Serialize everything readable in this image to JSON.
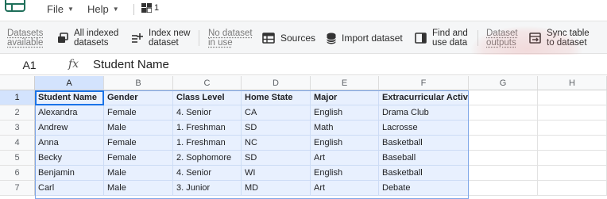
{
  "menu": {
    "file_label": "File",
    "help_label": "Help",
    "sheets_count": "1",
    "icons": {
      "app_logo": "table-grid-icon",
      "caret": "caret-down-icon",
      "sheets": "sheets-stack-icon"
    }
  },
  "toolbar": {
    "items": [
      {
        "id": "datasets-available",
        "label": "Datasets\navailable",
        "disabled": true,
        "icon": ""
      },
      {
        "id": "all-indexed",
        "label": "All indexed\ndatasets",
        "disabled": false,
        "icon": "datasets-icon"
      },
      {
        "id": "index-new",
        "label": "Index new\ndataset",
        "disabled": false,
        "icon": "index-add-icon"
      },
      {
        "id": "no-dataset",
        "label": "No dataset\nin use",
        "disabled": true,
        "icon": ""
      },
      {
        "id": "sources",
        "label": "Sources",
        "disabled": false,
        "icon": "table-icon"
      },
      {
        "id": "import-dataset",
        "label": "Import dataset",
        "disabled": false,
        "icon": "database-icon"
      },
      {
        "id": "find-and-use",
        "label": "Find and\nuse data",
        "disabled": false,
        "icon": "panel-icon"
      },
      {
        "id": "dataset-outputs",
        "label": "Dataset\noutputs",
        "disabled": true,
        "icon": ""
      },
      {
        "id": "sync-table",
        "label": "Sync table\nto dataset",
        "disabled": false,
        "icon": "sync-table-icon"
      }
    ]
  },
  "formula_bar": {
    "cell_ref": "A1",
    "fx_label": "fx",
    "value": "Student Name"
  },
  "grid": {
    "columns": [
      "A",
      "B",
      "C",
      "D",
      "E",
      "F",
      "G",
      "H"
    ],
    "selected_column": "A",
    "row_numbers": [
      "1",
      "2",
      "3",
      "4",
      "5",
      "6",
      "7"
    ],
    "selected_row": "1",
    "rows": [
      [
        "Student Name",
        "Gender",
        "Class Level",
        "Home State",
        "Major",
        "Extracurricular Activity",
        "",
        ""
      ],
      [
        "Alexandra",
        "Female",
        "4. Senior",
        "CA",
        "English",
        "Drama Club",
        "",
        ""
      ],
      [
        "Andrew",
        "Male",
        "1. Freshman",
        "SD",
        "Math",
        "Lacrosse",
        "",
        ""
      ],
      [
        "Anna",
        "Female",
        "1. Freshman",
        "NC",
        "English",
        "Basketball",
        "",
        ""
      ],
      [
        "Becky",
        "Female",
        "2. Sophomore",
        "SD",
        "Art",
        "Baseball",
        "",
        ""
      ],
      [
        "Benjamin",
        "Male",
        "4. Senior",
        "WI",
        "English",
        "Basketball",
        "",
        ""
      ],
      [
        "Carl",
        "Male",
        "3. Junior",
        "MD",
        "Art",
        "Debate",
        "",
        ""
      ]
    ],
    "colors": {
      "table_fill": "#e8f0fe",
      "selection_blue": "#1a73e8",
      "header_selected": "#d3e3fd"
    }
  }
}
